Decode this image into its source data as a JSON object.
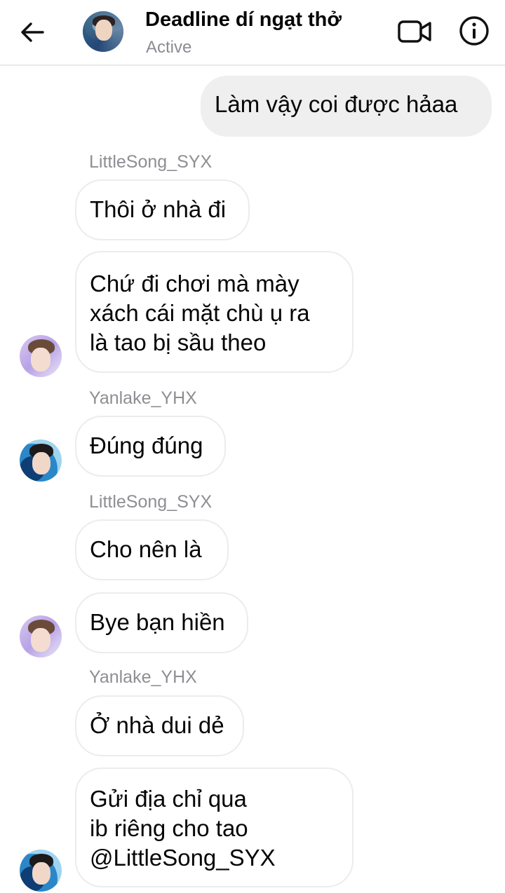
{
  "header": {
    "title": "Deadline dí ngạt thở",
    "status": "Active",
    "back_icon": "arrow-left-icon",
    "video_icon": "video-camera-icon",
    "info_icon": "info-icon"
  },
  "messages": [
    {
      "sender_label": "",
      "text": "Làm vậy coi được hảaa",
      "direction": "outgoing"
    },
    {
      "sender_label": "LittleSong_SYX",
      "text": "Thôi ở nhà đi"
    },
    {
      "text_lines": [
        "Chứ đi chơi mà mày",
        "xách cái mặt chù ụ ra",
        "là tao bị sầu theo"
      ]
    },
    {
      "sender_label": "Yanlake_YHX",
      "text": "Đúng đúng"
    },
    {
      "sender_label": "LittleSong_SYX",
      "text": "Cho nên là"
    },
    {
      "text": "Bye bạn hiền"
    },
    {
      "sender_label": "Yanlake_YHX",
      "text": "Ở nhà dui dẻ"
    },
    {
      "text_lines": [
        "Gửi địa chỉ qua",
        "ib riêng cho tao",
        "@LittleSong_SYX"
      ]
    }
  ]
}
